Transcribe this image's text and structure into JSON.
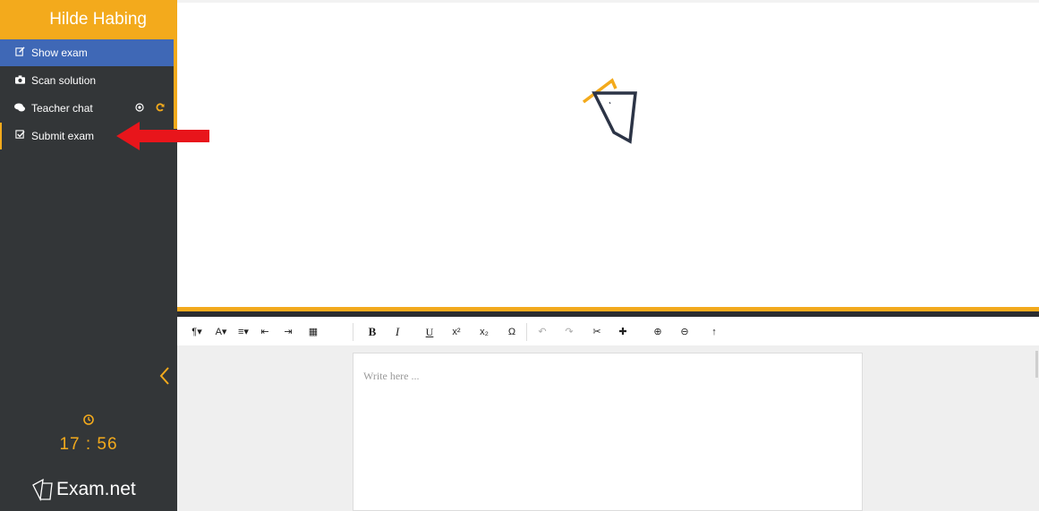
{
  "sidebar": {
    "user_name": "Hilde Habing",
    "items": [
      {
        "label": "Show exam",
        "icon": "edit-icon",
        "active": true
      },
      {
        "label": "Scan solution",
        "icon": "camera-icon"
      },
      {
        "label": "Teacher chat",
        "icon": "chat-icon",
        "extras": [
          "target-icon",
          "refresh-icon"
        ]
      },
      {
        "label": "Submit exam",
        "icon": "checkbox-icon"
      }
    ],
    "timer": "17 : 56",
    "logo_text": "Exam.net"
  },
  "zoom_toolbar": [
    "zoom-in-icon",
    "zoom-out-icon",
    "horizontal-split-icon",
    "vertical-split-icon",
    "document-icon"
  ],
  "editor": {
    "toolbar": [
      {
        "name": "paragraph-format-button",
        "label": "¶▾"
      },
      {
        "name": "font-size-button",
        "label": "A▾"
      },
      {
        "name": "align-button",
        "label": "≡▾"
      },
      {
        "name": "outdent-button",
        "label": "⇤"
      },
      {
        "name": "indent-button",
        "label": "⇥"
      },
      {
        "name": "table-button",
        "label": "▦"
      },
      {
        "name": "bold-button",
        "label": "B"
      },
      {
        "name": "italic-button",
        "label": "I"
      },
      {
        "name": "underline-button",
        "label": "U"
      },
      {
        "name": "superscript-button",
        "label": "x²"
      },
      {
        "name": "subscript-button",
        "label": "x₂"
      },
      {
        "name": "special-char-button",
        "label": "Ω"
      },
      {
        "name": "undo-button",
        "label": "↶"
      },
      {
        "name": "redo-button",
        "label": "↷"
      },
      {
        "name": "cut-button",
        "label": "✂"
      },
      {
        "name": "plugin-button",
        "label": "✚"
      },
      {
        "name": "zoom-in-editor-button",
        "label": "⊕"
      },
      {
        "name": "zoom-out-editor-button",
        "label": "⊖"
      },
      {
        "name": "scroll-up-button",
        "label": "↑"
      }
    ],
    "placeholder": "Write here ..."
  },
  "colors": {
    "accent": "#f3aa1c",
    "sidebar_bg": "#333638",
    "active_item": "#3f68b6",
    "arrow": "#e8151b"
  }
}
